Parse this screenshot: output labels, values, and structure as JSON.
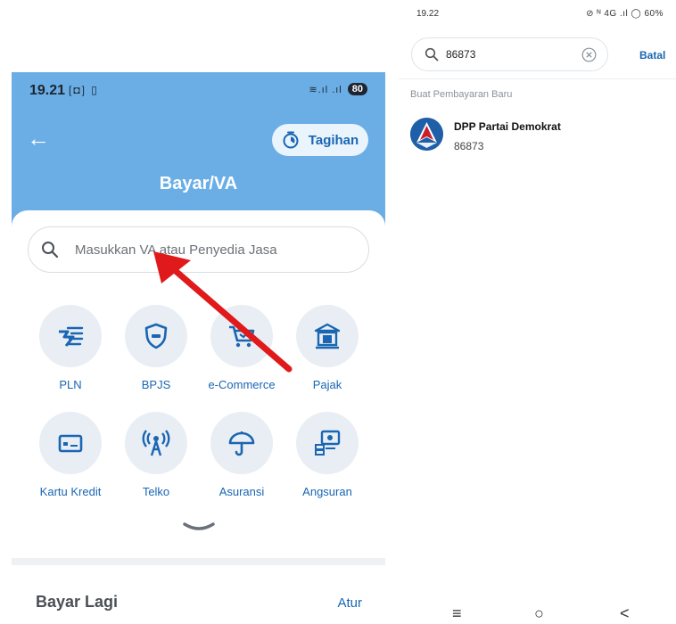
{
  "left_screen": {
    "status_bar": {
      "time": "19.21",
      "icons_left": "[◘] ▯",
      "signal": "≋.ıl .ıl",
      "battery": "80"
    },
    "header": {
      "title": "Bayar/VA",
      "tagihan_label": "Tagihan"
    },
    "search": {
      "placeholder": "Masukkan VA atau Penyedia Jasa"
    },
    "categories": [
      {
        "label": "PLN",
        "icon": "lightning-icon"
      },
      {
        "label": "BPJS",
        "icon": "shield-icon"
      },
      {
        "label": "e-Commerce",
        "icon": "cart-icon"
      },
      {
        "label": "Pajak",
        "icon": "bank-icon"
      },
      {
        "label": "Kartu Kredit",
        "icon": "credit-card-icon"
      },
      {
        "label": "Telko",
        "icon": "antenna-icon"
      },
      {
        "label": "Asuransi",
        "icon": "umbrella-icon"
      },
      {
        "label": "Angsuran",
        "icon": "installment-icon"
      }
    ],
    "bayar_lagi": {
      "title": "Bayar Lagi",
      "action": "Atur"
    }
  },
  "right_screen": {
    "status_bar": {
      "time": "19.22",
      "icons": "⊘ ᴺ 4G .ıl ◯ 60%"
    },
    "search": {
      "value": "86873",
      "cancel_label": "Batal"
    },
    "section_label": "Buat Pembayaran Baru",
    "result": {
      "name": "DPP Partai Demokrat",
      "code": "86873"
    },
    "nav": {
      "menu": "≡",
      "home": "○",
      "back": "<"
    }
  },
  "colors": {
    "header_blue": "#6aaee5",
    "accent_blue": "#1a66b3",
    "arrow_red": "#e0191b"
  }
}
